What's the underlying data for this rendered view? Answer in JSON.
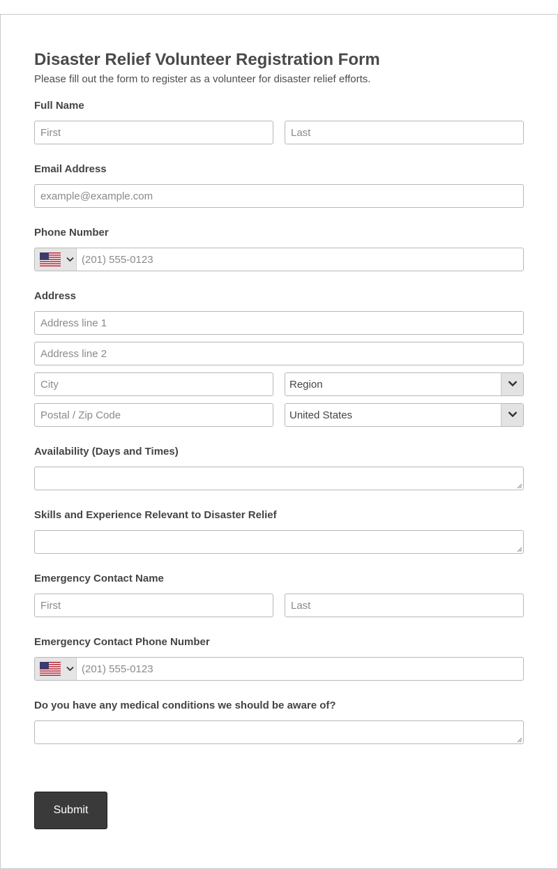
{
  "form": {
    "title": "Disaster Relief Volunteer Registration Form",
    "subtitle": "Please fill out the form to register as a volunteer for disaster relief efforts."
  },
  "full_name": {
    "label": "Full Name",
    "first_placeholder": "First",
    "last_placeholder": "Last"
  },
  "email": {
    "label": "Email Address",
    "placeholder": "example@example.com"
  },
  "phone": {
    "label": "Phone Number",
    "country_icon": "us-flag-icon",
    "placeholder": "(201) 555-0123"
  },
  "address": {
    "label": "Address",
    "line1_placeholder": "Address line 1",
    "line2_placeholder": "Address line 2",
    "city_placeholder": "City",
    "region_value": "Region",
    "postal_placeholder": "Postal / Zip Code",
    "country_value": "United States"
  },
  "availability": {
    "label": "Availability (Days and Times)"
  },
  "skills": {
    "label": "Skills and Experience Relevant to Disaster Relief"
  },
  "emergency_name": {
    "label": "Emergency Contact Name",
    "first_placeholder": "First",
    "last_placeholder": "Last"
  },
  "emergency_phone": {
    "label": "Emergency Contact Phone Number",
    "country_icon": "us-flag-icon",
    "placeholder": "(201) 555-0123"
  },
  "medical": {
    "label": "Do you have any medical conditions we should be aware of?"
  },
  "submit": {
    "label": "Submit"
  },
  "colors": {
    "button_bg": "#3a3a3a",
    "border": "#b8b8b8",
    "text": "#444444"
  }
}
